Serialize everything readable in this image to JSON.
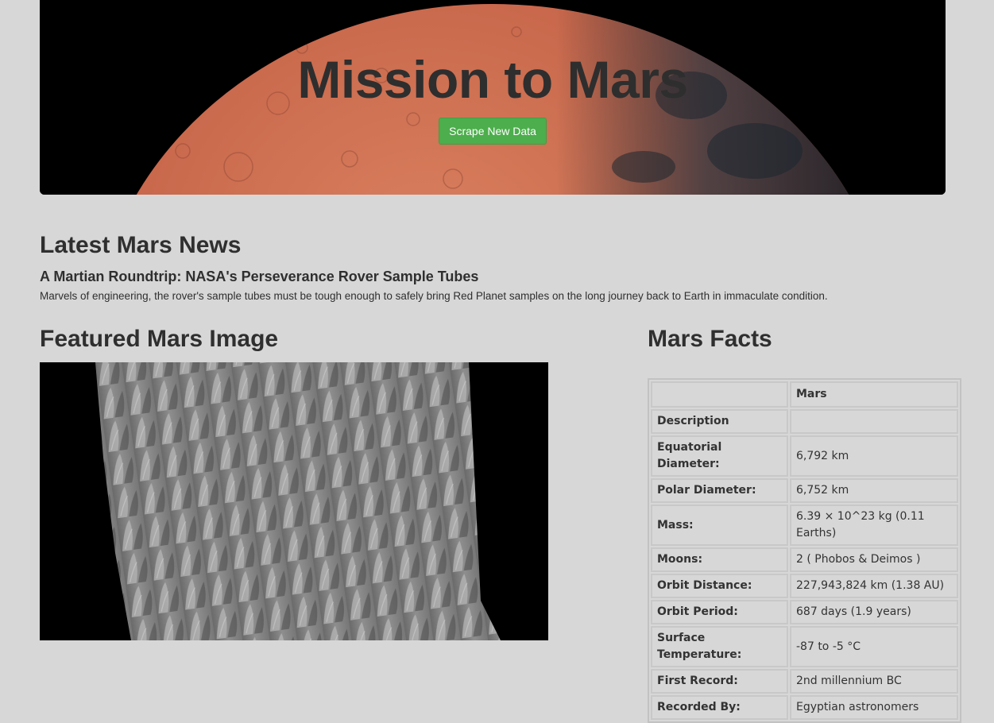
{
  "header": {
    "title": "Mission to Mars",
    "scrape_button_label": "Scrape New Data"
  },
  "news": {
    "section_heading": "Latest Mars News",
    "title": "A Martian Roundtrip: NASA's Perseverance Rover Sample Tubes",
    "paragraph": "Marvels of engineering, the rover's sample tubes must be tough enough to safely bring Red Planet samples on the long journey back to Earth in immaculate condition."
  },
  "featured_image": {
    "section_heading": "Featured Mars Image"
  },
  "facts": {
    "section_heading": "Mars Facts",
    "column_header": "Mars",
    "rows": [
      {
        "label": "Description",
        "value": ""
      },
      {
        "label": "Equatorial Diameter:",
        "value": "6,792 km"
      },
      {
        "label": "Polar Diameter:",
        "value": "6,752 km"
      },
      {
        "label": "Mass:",
        "value": "6.39 × 10^23 kg (0.11 Earths)"
      },
      {
        "label": "Moons:",
        "value": "2 ( Phobos & Deimos )"
      },
      {
        "label": "Orbit Distance:",
        "value": "227,943,824 km (1.38 AU)"
      },
      {
        "label": "Orbit Period:",
        "value": "687 days (1.9 years)"
      },
      {
        "label": "Surface Temperature:",
        "value": "-87 to -5 °C"
      },
      {
        "label": "First Record:",
        "value": "2nd millennium BC"
      },
      {
        "label": "Recorded By:",
        "value": "Egyptian astronomers"
      }
    ]
  },
  "colors": {
    "page_background": "#d7d7d7",
    "button_green": "#4cae4c",
    "mars_surface": "#c8674b"
  }
}
